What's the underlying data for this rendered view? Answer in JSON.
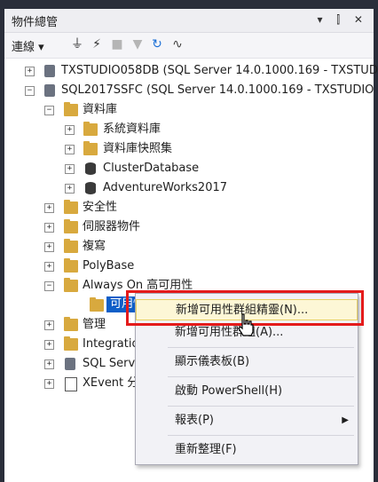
{
  "panel": {
    "title": "物件總管",
    "title_buttons": "▾ ⫿ ✕"
  },
  "toolbar": {
    "connect": "連線 ▾"
  },
  "tree": {
    "server1": "TXSTUDIO058DB (SQL Server 14.0.1000.169 - TXSTUD",
    "server2": "SQL2017SSFC (SQL Server 14.0.1000.169 - TXSTUDIO",
    "databases": "資料庫",
    "system_db": "系統資料庫",
    "db_snapshots": "資料庫快照集",
    "cluster_db": "ClusterDatabase",
    "adventure_db": "AdventureWorks2017",
    "security": "安全性",
    "server_objects": "伺服器物件",
    "replication": "複寫",
    "polybase": "PolyBase",
    "always_on": "Always On 高可用性",
    "availability": "可用性群組",
    "management": "管理",
    "integration": "Integratio",
    "sql_server_agent": "SQL Serve",
    "xevent": "XEvent 分"
  },
  "context_menu": {
    "items": [
      "新增可用性群組精靈(N)...",
      "新增可用性群組(A)...",
      "顯示儀表板(B)",
      "啟動 PowerShell(H)",
      "報表(P)",
      "重新整理(F)"
    ]
  },
  "colors": {
    "selection": "#0f5fc8",
    "highlight_box": "#e41b1b",
    "folder": "#d8a93e"
  }
}
